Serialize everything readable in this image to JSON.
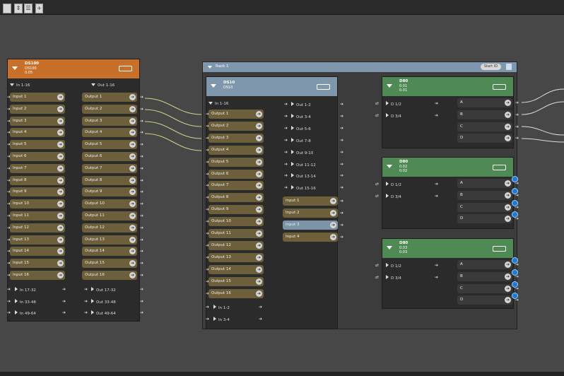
{
  "toolbar": {
    "btn_up_down": "⇕",
    "btn_stack": "☰",
    "btn_plus": "+",
    "btn_dropdown": "▾"
  },
  "ds100": {
    "title": "DS100",
    "subtitle": "DS100",
    "ip": "0.05",
    "in_group": "In 1-16",
    "out_group": "Out 1-16",
    "inputs": [
      "Input 1",
      "Input 2",
      "Input 3",
      "Input 4",
      "Input 5",
      "Input 6",
      "Input 7",
      "Input 8",
      "Input 9",
      "Input 10",
      "Input 11",
      "Input 12",
      "Input 13",
      "Input 14",
      "Input 15",
      "Input 16"
    ],
    "outputs": [
      "Output 1",
      "Output 2",
      "Output 3",
      "Output 4",
      "Output 5",
      "Output 6",
      "Output 7",
      "Output 8",
      "Output 9",
      "Output 10",
      "Output 11",
      "Output 12",
      "Output 13",
      "Output 14",
      "Output 15",
      "Output 16"
    ],
    "in_more": [
      "In 17-32",
      "In 33-48",
      "In 49-64"
    ],
    "out_more": [
      "Out 17-32",
      "Out 33-48",
      "Out 49-64"
    ]
  },
  "rack": {
    "label": "Rack 1",
    "start_id": "Start ID"
  },
  "ds10": {
    "title": "DS10",
    "subtitle": "DS10",
    "in_group": "In 1-16",
    "outputs": [
      "Output 1",
      "Output 2",
      "Output 3",
      "Output 4",
      "Output 5",
      "Output 6",
      "Output 7",
      "Output 8",
      "Output 9",
      "Output 10",
      "Output 11",
      "Output 12",
      "Output 13",
      "Output 14",
      "Output 15",
      "Output 16"
    ],
    "in_more": [
      "In 1-2",
      "In 3-4"
    ],
    "out_groups": [
      "Out 1-2",
      "Out 3-4",
      "Out 5-6",
      "Out 7-8",
      "Out 9-10",
      "Out 11-12",
      "Out 13-14",
      "Out 15-16"
    ],
    "inputs": [
      "Input 1",
      "Input 2",
      "Input 3",
      "Input 4"
    ]
  },
  "d80_1": {
    "title": "D80",
    "l2": "0.01",
    "l3": "0.01",
    "pairs": [
      "D 1/2",
      "D 3/4"
    ],
    "channels": [
      "A",
      "B",
      "C",
      "D"
    ]
  },
  "d80_2": {
    "title": "D80",
    "l2": "0.02",
    "l3": "0.02",
    "pairs": [
      "D 1/2",
      "D 3/4"
    ],
    "channels": [
      "A",
      "B",
      "C",
      "D"
    ]
  },
  "d80_3": {
    "title": "D80",
    "l2": "0.03",
    "l3": "0.03",
    "pairs": [
      "D 1/2",
      "D 3/4"
    ],
    "channels": [
      "A",
      "B",
      "C",
      "D"
    ]
  },
  "colors": {
    "ds100_head": "#c8702a",
    "ds10_head": "#7f97ac",
    "d80_head": "#4f8a55",
    "wire_yellow": "#d8cf8a",
    "wire_white": "#e8e8e8"
  }
}
